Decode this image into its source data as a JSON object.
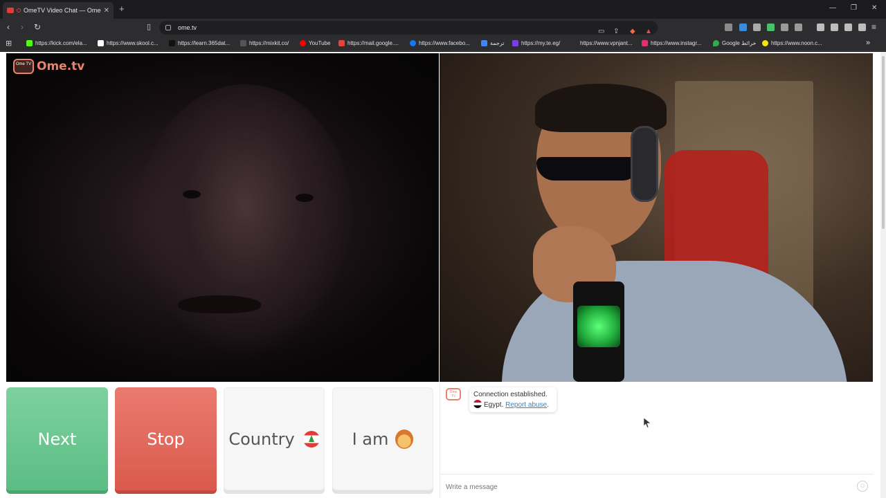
{
  "browser": {
    "tab_title": "OmeTV Video Chat — Omeg",
    "tab_close": "✕",
    "new_tab": "+",
    "address": "ome.tv",
    "window_controls": [
      "—",
      "❐",
      "✕"
    ],
    "bookmarks": [
      {
        "label": "https://kick.com/ela...",
        "color": "#53fc18"
      },
      {
        "label": "https://www.skool.c...",
        "color": "#ffffff"
      },
      {
        "label": "https://learn.365dat...",
        "color": "#1a1a1a"
      },
      {
        "label": "https://mixkit.co/",
        "color": "#555555"
      },
      {
        "label": "YouTube",
        "color": "#ff0000"
      },
      {
        "label": "https://mail.google....",
        "color": "#ea4335"
      },
      {
        "label": "https://www.facebo...",
        "color": "#1877f2"
      },
      {
        "label": "ترجمة",
        "color": "#4285f4"
      },
      {
        "label": "https://my.te.eg/",
        "color": "#7b3fe4"
      },
      {
        "label": "https://www.vpnjant...",
        "color": "#2d2d30"
      },
      {
        "label": "https://www.instagr...",
        "color": "#e1306c"
      },
      {
        "label": "Google خرائط",
        "color": "#34a853"
      },
      {
        "label": "https://www.noon.c...",
        "color": "#f3e600"
      }
    ],
    "bookmarks_more": "»"
  },
  "site": {
    "logo_badge": "Ome TV",
    "logo_text": "Ome.tv"
  },
  "controls": {
    "next_label": "Next",
    "stop_label": "Stop",
    "country_label": "Country",
    "iam_label": "I am"
  },
  "chat": {
    "avatar_text": "Ome TV",
    "message_line1": "Connection established.",
    "message_country": "Egypt.",
    "report_link": "Report abuse",
    "report_suffix": ".",
    "input_placeholder": "Write a message",
    "emoji_button": "☺"
  },
  "colors": {
    "next": "#6cc892",
    "stop": "#e26a5d",
    "brand": "#e9826d",
    "link": "#3b82c4"
  }
}
